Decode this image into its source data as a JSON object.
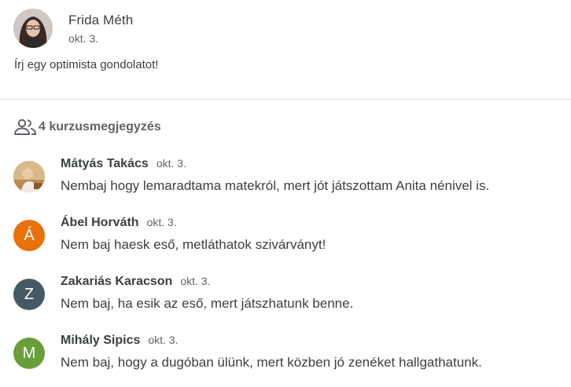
{
  "post": {
    "author": "Frida Méth",
    "date": "okt. 3.",
    "body": "Írj egy optimista gondolatot!"
  },
  "comments_header": {
    "icon": "people-icon",
    "label": "4 kurzusmegjegyzés"
  },
  "comments": [
    {
      "author": "Mátyás Takács",
      "date": "okt. 3.",
      "text": "Nembaj hogy lemaradtama matekról, mert jót játszottam Anita nénivel is.",
      "avatar": "photo"
    },
    {
      "author": "Ábel Horváth",
      "date": "okt. 3.",
      "text": "Nem baj haesk eső, metláthatok szivárványt!",
      "avatar_letter": "Á",
      "avatar_color": "#e8710a"
    },
    {
      "author": "Zakariás Karacson",
      "date": "okt. 3.",
      "text": "Nem baj, ha esik az eső, mert játszhatunk benne.",
      "avatar_letter": "Z",
      "avatar_color": "#455a64"
    },
    {
      "author": "Mihály Sipics",
      "date": "okt. 3.",
      "text": "Nem baj, hogy a dugóban ülünk, mert közben jó zenéket hallgathatunk.",
      "avatar_letter": "M",
      "avatar_color": "#689f38"
    }
  ]
}
